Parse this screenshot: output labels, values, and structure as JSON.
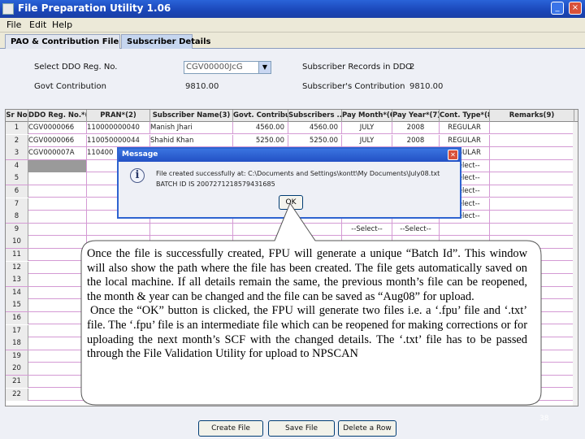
{
  "window": {
    "title": "File Preparation Utility 1.06",
    "controls": [
      "_",
      "□",
      "×"
    ]
  },
  "menu": [
    "File",
    "Edit",
    "Help"
  ],
  "tabs": [
    "PAO & Contribution File Details",
    "Subscriber Details"
  ],
  "form": {
    "ddo_label": "Select DDO Reg. No.",
    "ddo_value": "CGV00000JcG",
    "govt_label": "Govt Contribution",
    "govt_value": "9810.00",
    "records_label": "Subscriber Records in DDO",
    "records_value": "2",
    "sub_contrib_label": "Subscriber's Contribution",
    "sub_contrib_value": "9810.00"
  },
  "table": {
    "headers": [
      "Sr No",
      "DDO Reg. No.*(1)",
      "PRAN*(2)",
      "Subscriber Name(3)",
      "Govt. Contribu...",
      "Subscribers ...",
      "Pay Month*(6)",
      "Pay Year*(7)",
      "Cont. Type*(8)",
      "Remarks(9)"
    ],
    "rows": [
      [
        "1",
        "CGV0000066",
        "110000000040",
        "Manish Jhari",
        "4560.00",
        "4560.00",
        "JULY",
        "2008",
        "REGULAR",
        ""
      ],
      [
        "2",
        "CGV0000066",
        "110050000044",
        "Shahid Khan",
        "5250.00",
        "5250.00",
        "JULY",
        "2008",
        "REGULAR",
        ""
      ],
      [
        "3",
        "CGV000007A",
        "110400",
        "",
        "",
        "",
        "",
        "",
        "REGULAR",
        ""
      ],
      [
        "4",
        "",
        "",
        "",
        "",
        "",
        "",
        "",
        "--Select--",
        ""
      ],
      [
        "5",
        "",
        "",
        "",
        "",
        "",
        "",
        "",
        "--Select--",
        ""
      ],
      [
        "6",
        "",
        "",
        "",
        "",
        "",
        "",
        "",
        "--Select--",
        ""
      ],
      [
        "7",
        "",
        "",
        "",
        "",
        "",
        "",
        "",
        "--Select--",
        ""
      ],
      [
        "8",
        "",
        "",
        "",
        "",
        "",
        "--Select--",
        "--Select--",
        "--Select--",
        ""
      ],
      [
        "9",
        "",
        "",
        "",
        "",
        "",
        "--Select--",
        "--Select--",
        "",
        ""
      ],
      [
        "10",
        "",
        "",
        "",
        "",
        "",
        "",
        "",
        "",
        ""
      ],
      [
        "11",
        "",
        "",
        "",
        "",
        "",
        "",
        "",
        "",
        ""
      ],
      [
        "12",
        "",
        "",
        "",
        "",
        "",
        "",
        "",
        "",
        ""
      ],
      [
        "13",
        "",
        "",
        "",
        "",
        "",
        "",
        "",
        "",
        ""
      ],
      [
        "14",
        "",
        "",
        "",
        "",
        "",
        "",
        "",
        "",
        ""
      ],
      [
        "15",
        "",
        "",
        "",
        "",
        "",
        "",
        "",
        "",
        ""
      ],
      [
        "16",
        "",
        "",
        "",
        "",
        "",
        "",
        "",
        "",
        ""
      ],
      [
        "17",
        "",
        "",
        "",
        "",
        "",
        "",
        "",
        "",
        ""
      ],
      [
        "18",
        "",
        "",
        "",
        "",
        "",
        "",
        "",
        "",
        ""
      ],
      [
        "19",
        "",
        "",
        "",
        "",
        "",
        "",
        "",
        "",
        ""
      ],
      [
        "20",
        "",
        "",
        "",
        "",
        "",
        "",
        "",
        "",
        ""
      ],
      [
        "21",
        "",
        "",
        "",
        "",
        "",
        "",
        "",
        "",
        ""
      ],
      [
        "22",
        "",
        "",
        "",
        "",
        "",
        "",
        "",
        "",
        ""
      ]
    ]
  },
  "dialog": {
    "title": "Message",
    "message_line1": "File created successfully at: C:\\Documents and Settings\\kontt\\My Documents\\July08.txt",
    "message_line2": "BATCH ID IS 2007271218579431685",
    "ok_label": "OK"
  },
  "callout": {
    "para1": "Once the file is successfully created, FPU will generate a unique “Batch Id”. This window will also show the path where the file has been created. The file gets automatically saved on the local machine. If all details remain the same, the previous month’s file can be reopened, the month & year can be changed and the file can be saved as “Aug08” for upload.",
    "para2": "Once the “OK” button is clicked, the FPU will generate two files i.e. a ‘.fpu’ file and ‘.txt’ file. The ‘.fpu’ file is an intermediate file which can be reopened for making corrections or for uploading the next month’s SCF with the changed details. The ‘.txt’ file has to be passed through the File Validation Utility for upload to NPSCAN"
  },
  "buttons": {
    "create_file": "Create File",
    "save_file": "Save File",
    "delete_row": "Delete a Row"
  },
  "page_number": "38"
}
